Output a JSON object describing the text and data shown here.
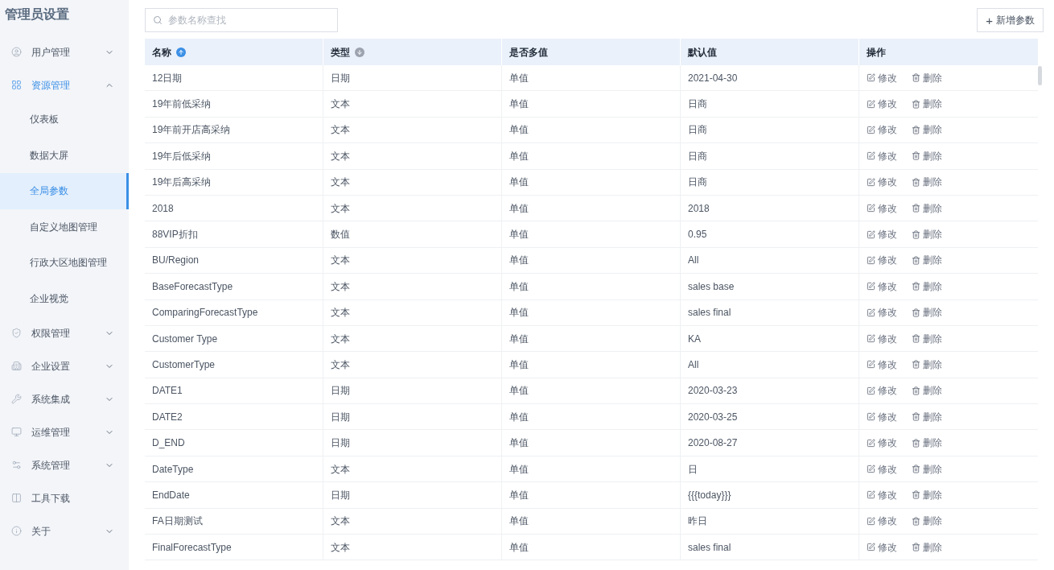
{
  "sidebar": {
    "title": "管理员设置",
    "items": [
      {
        "kind": "group",
        "label": "用户管理",
        "expanded": false
      },
      {
        "kind": "group",
        "label": "资源管理",
        "expanded": true,
        "children": [
          {
            "label": "仪表板",
            "selected": false
          },
          {
            "label": "数据大屏",
            "selected": false
          },
          {
            "label": "全局参数",
            "selected": true
          },
          {
            "label": "自定义地图管理",
            "selected": false
          },
          {
            "label": "行政大区地图管理",
            "selected": false
          },
          {
            "label": "企业视觉",
            "selected": false
          }
        ]
      },
      {
        "kind": "group",
        "label": "权限管理",
        "expanded": false
      },
      {
        "kind": "group",
        "label": "企业设置",
        "expanded": false
      },
      {
        "kind": "group",
        "label": "系统集成",
        "expanded": false
      },
      {
        "kind": "group",
        "label": "运维管理",
        "expanded": false
      },
      {
        "kind": "group",
        "label": "系统管理",
        "expanded": false
      },
      {
        "kind": "link",
        "label": "工具下载"
      },
      {
        "kind": "group",
        "label": "关于",
        "expanded": false
      }
    ]
  },
  "search": {
    "placeholder": "参数名称查找"
  },
  "add_button": {
    "icon": "+",
    "label": "新增参数"
  },
  "table": {
    "columns": [
      {
        "label": "名称",
        "sort_active": true
      },
      {
        "label": "类型",
        "sort_active": false
      },
      {
        "label": "是否多值"
      },
      {
        "label": "默认值"
      },
      {
        "label": "操作"
      }
    ],
    "rows": [
      {
        "cells": [
          "12日期",
          "日期",
          "单值",
          "2021-04-30"
        ],
        "actions": [
          "修改",
          "删除"
        ]
      },
      {
        "cells": [
          "19年前低采纳",
          "文本",
          "单值",
          "日商"
        ],
        "actions": [
          "修改",
          "删除"
        ]
      },
      {
        "cells": [
          "19年前开店高采纳",
          "文本",
          "单值",
          "日商"
        ],
        "actions": [
          "修改",
          "删除"
        ]
      },
      {
        "cells": [
          "19年后低采纳",
          "文本",
          "单值",
          "日商"
        ],
        "actions": [
          "修改",
          "删除"
        ]
      },
      {
        "cells": [
          "19年后高采纳",
          "文本",
          "单值",
          "日商"
        ],
        "actions": [
          "修改",
          "删除"
        ]
      },
      {
        "cells": [
          "2018",
          "文本",
          "单值",
          "2018"
        ],
        "actions": [
          "修改",
          "删除"
        ]
      },
      {
        "cells": [
          "88VIP折扣",
          "数值",
          "单值",
          "0.95"
        ],
        "actions": [
          "修改",
          "删除"
        ]
      },
      {
        "cells": [
          "BU/Region",
          "文本",
          "单值",
          "All"
        ],
        "actions": [
          "修改",
          "删除"
        ]
      },
      {
        "cells": [
          "BaseForecastType",
          "文本",
          "单值",
          "sales base"
        ],
        "actions": [
          "修改",
          "删除"
        ]
      },
      {
        "cells": [
          "ComparingForecastType",
          "文本",
          "单值",
          "sales final"
        ],
        "actions": [
          "修改",
          "删除"
        ]
      },
      {
        "cells": [
          "Customer Type",
          "文本",
          "单值",
          "KA"
        ],
        "actions": [
          "修改",
          "删除"
        ]
      },
      {
        "cells": [
          "CustomerType",
          "文本",
          "单值",
          "All"
        ],
        "actions": [
          "修改",
          "删除"
        ]
      },
      {
        "cells": [
          "DATE1",
          "日期",
          "单值",
          "2020-03-23"
        ],
        "actions": [
          "修改",
          "删除"
        ]
      },
      {
        "cells": [
          "DATE2",
          "日期",
          "单值",
          "2020-03-25"
        ],
        "actions": [
          "修改",
          "删除"
        ]
      },
      {
        "cells": [
          "D_END",
          "日期",
          "单值",
          "2020-08-27"
        ],
        "actions": [
          "修改",
          "删除"
        ]
      },
      {
        "cells": [
          "DateType",
          "文本",
          "单值",
          "日"
        ],
        "actions": [
          "修改",
          "删除"
        ]
      },
      {
        "cells": [
          "EndDate",
          "日期",
          "单值",
          "{{{today}}}"
        ],
        "actions": [
          "修改",
          "删除"
        ]
      },
      {
        "cells": [
          "FA日期测试",
          "文本",
          "单值",
          "昨日"
        ],
        "actions": [
          "修改",
          "删除"
        ]
      },
      {
        "cells": [
          "FinalForecastType",
          "文本",
          "单值",
          "sales final"
        ],
        "actions": [
          "修改",
          "删除"
        ]
      }
    ]
  }
}
